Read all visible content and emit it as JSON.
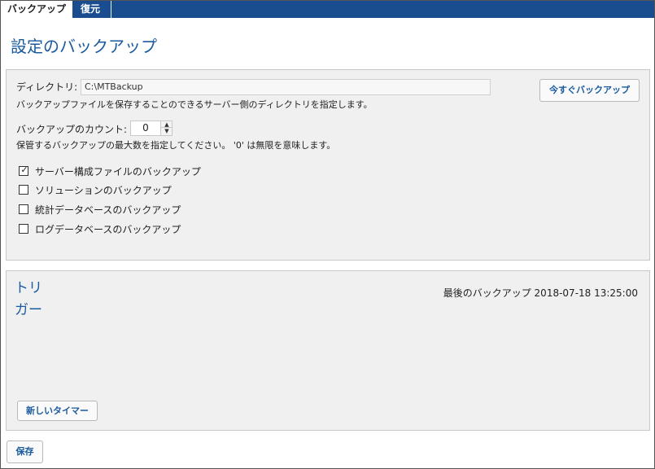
{
  "tabs": [
    {
      "label": "バックアップ",
      "active": true
    },
    {
      "label": "復元",
      "active": false
    }
  ],
  "page_title": "設定のバックアップ",
  "directory": {
    "label": "ディレクトリ:",
    "value": "C:\\MTBackup",
    "description": "バックアップファイルを保存することのできるサーバー側のディレクトリを指定します。"
  },
  "backup_now_label": "今すぐバックアップ",
  "backup_count": {
    "label": "バックアップのカウント:",
    "value": "0",
    "description": "保管するバックアップの最大数を指定してください。 '0' は無限を意味します。"
  },
  "options": [
    {
      "label": "サーバー構成ファイルのバックアップ",
      "checked": true
    },
    {
      "label": "ソリューションのバックアップ",
      "checked": false
    },
    {
      "label": "統計データベースのバックアップ",
      "checked": false
    },
    {
      "label": "ログデータベースのバックアップ",
      "checked": false
    }
  ],
  "trigger": {
    "title": "トリガー",
    "last_backup_label": "最後のバックアップ 2018-07-18 13:25:00",
    "new_timer_label": "新しいタイマー"
  },
  "save_label": "保存",
  "colors": {
    "accent": "#1a5a9e",
    "tabbar": "#1a4d8f",
    "panel": "#f0f0f0"
  }
}
